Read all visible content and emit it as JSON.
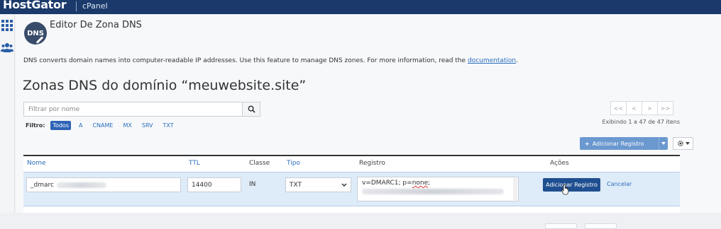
{
  "topbar": {
    "brand": "HostGator",
    "product": "cPanel"
  },
  "rail": {
    "icons": [
      "apps-grid-icon",
      "users-icon"
    ]
  },
  "header": {
    "badge": "DNS",
    "title": "Editor De Zona DNS"
  },
  "description": {
    "text": "DNS converts domain names into computer-readable IP addresses. Use this feature to manage DNS zones. For more information, read the ",
    "link": "documentation",
    "end": "."
  },
  "zone_title": "Zonas DNS do domínio “meuwebsite.site”",
  "search": {
    "placeholder": "Filtrar por nome"
  },
  "filter": {
    "label": "Filtro:",
    "options": [
      "Todos",
      "A",
      "CNAME",
      "MX",
      "SRV",
      "TXT"
    ],
    "active": "Todos"
  },
  "pagination": {
    "first": "<<",
    "prev": "<",
    "next": ">",
    "last": ">>",
    "showing": "Exibindo 1 a 47 de 47 itens"
  },
  "toolbar": {
    "add_label": "Adicionar Registro"
  },
  "table": {
    "headers": {
      "name": "Nome",
      "ttl": "TTL",
      "class": "Classe",
      "type": "Tipo",
      "record": "Registro",
      "actions": "Ações"
    }
  },
  "edit_row": {
    "name": "_dmarc",
    "ttl": "14400",
    "class": "IN",
    "type": "TXT",
    "record_prefix": "v=DMARC1; p=",
    "record_squiggle": "none",
    "record_suffix": ";",
    "add_button": "Adicionar Registro",
    "cancel": "Cancelar"
  },
  "colors": {
    "topbar": "#1b3a6b",
    "accent": "#2e63b7",
    "link": "#2a6fbd",
    "edit_row": "#deebf8"
  }
}
